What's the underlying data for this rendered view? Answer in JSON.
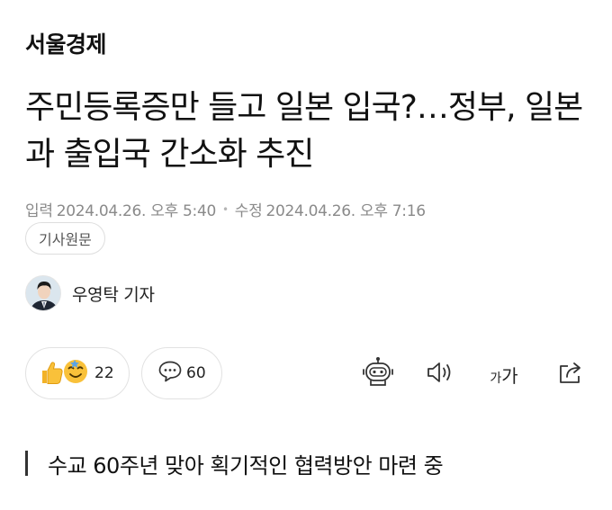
{
  "press": {
    "name": "서울경제"
  },
  "article": {
    "headline": "주민등록증만 들고 일본 입국?…정부, 일본과 출입국 간소화 추진",
    "subheading": "수교 60주년 맞아 획기적인 협력방안 마련 중"
  },
  "meta": {
    "published_label": "입력",
    "published": "2024.04.26. 오후 5:40",
    "separator": "•",
    "modified_label": "수정",
    "modified": "2024.04.26. 오후 7:16"
  },
  "original_article_button": {
    "label": "기사원문"
  },
  "reporter": {
    "name": "우영탁 기자"
  },
  "reactions": {
    "count": "22",
    "icon": "thumbs-up-and-face-emoji"
  },
  "comments": {
    "count": "60",
    "icon": "speech-bubble-icon"
  },
  "toolbar": {
    "items": [
      "robot-summary-icon",
      "speaker-icon",
      "font-size-icon",
      "share-icon"
    ],
    "font_size_small": "가",
    "font_size_large": "가"
  },
  "colors": {
    "text": "#111111",
    "meta": "#8a8a8a",
    "border": "#e2e2e2",
    "emoji": "#f9c13a"
  }
}
